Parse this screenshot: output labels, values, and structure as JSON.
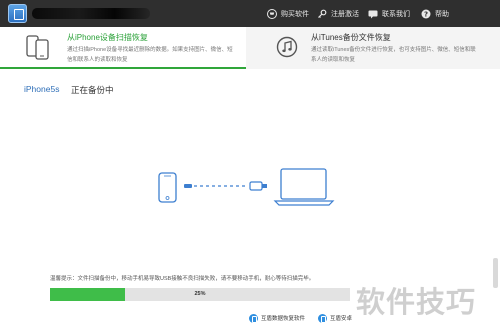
{
  "titlebar": {
    "links": [
      {
        "label": "购买软件",
        "icon": "shopping-cart-icon"
      },
      {
        "label": "注册激活",
        "icon": "key-icon"
      },
      {
        "label": "联系我们",
        "icon": "chat-icon"
      },
      {
        "label": "帮助",
        "icon": "help-icon"
      }
    ]
  },
  "modes": [
    {
      "title": "从iPhone设备扫描恢复",
      "description": "通过扫描iPhone设备寻找最近删除的数据。如果支持图片、微信、短信和联系人的读取和恢复",
      "icon": "phone-devices-icon",
      "active": true
    },
    {
      "title": "从iTunes备份文件恢复",
      "description": "通过读取iTunes备份文件进行恢复，也可支持图片、微信、短信和联系人的读取和恢复",
      "icon": "itunes-icon",
      "active": false
    }
  ],
  "device": {
    "name": "iPhone5s",
    "status": "正在备份中"
  },
  "tip": "温馨提示：文件扫描备份中，移动手机易导致USB接触不良扫描失败，请不要移动手机，耐心等待扫描完毕。",
  "progress": {
    "value": 0.25,
    "label": "25%"
  },
  "bottom_links": [
    {
      "label": "互盾数据恢复软件",
      "icon": "recovery-app-icon"
    },
    {
      "label": "互盾安卓",
      "icon": "android-app-icon"
    }
  ],
  "watermark": "软件技巧",
  "colors": {
    "accent_green": "#30a63a",
    "device_blue": "#2f6fb8",
    "titlebar": "#2f2f2f",
    "progress_fill": "#3fbd49"
  }
}
